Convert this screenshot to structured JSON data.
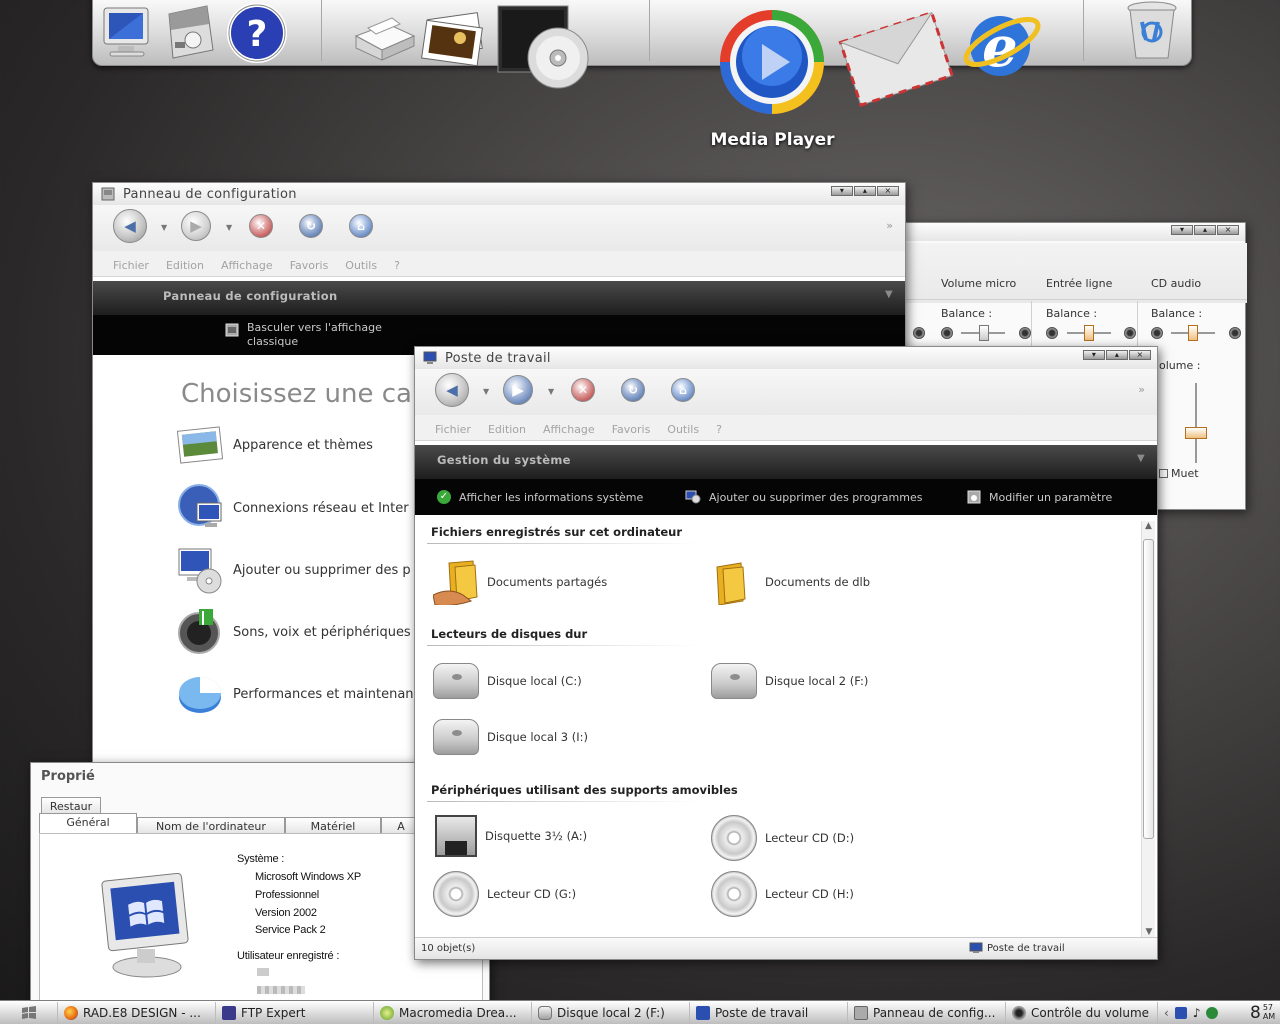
{
  "dock": {
    "hover_label": "Media Player",
    "icons": [
      "monitor-icon",
      "control-panel-icon",
      "help-icon",
      "printer-icon",
      "photos-icon",
      "cd-icon",
      "media-player-icon",
      "mail-icon",
      "internet-explorer-icon",
      "recycle-bin-icon"
    ]
  },
  "control_panel": {
    "title": "Panneau de configuration",
    "menu": [
      "Fichier",
      "Edition",
      "Affichage",
      "Favoris",
      "Outils",
      "?"
    ],
    "task_header": "Panneau de configuration",
    "task_link": "Basculer vers l'affichage classique",
    "task_link_line1": "Basculer vers l'affichage",
    "task_link_line2": "classique",
    "heading": "Choisissez une ca",
    "categories": [
      "Apparence et thèmes",
      "Connexions réseau et Inter",
      "Ajouter ou supprimer des p",
      "Sons, voix et périphériques",
      "Performances et maintenan"
    ]
  },
  "volume": {
    "columns": [
      "Volume micro",
      "Entrée ligne",
      "CD audio"
    ],
    "balance_label": "Balance :",
    "volume_label": "olume :",
    "mute_label": "Muet"
  },
  "properties": {
    "title": "Proprié",
    "tabs_top": [
      "Restaur"
    ],
    "tabs": [
      "Général",
      "Nom de l'ordinateur",
      "Matériel",
      "A"
    ],
    "system_label": "Système :",
    "system_lines": [
      "Microsoft Windows XP",
      "Professionnel",
      "Version 2002",
      "Service Pack 2"
    ],
    "user_label": "Utilisateur enregistré :"
  },
  "my_computer": {
    "title": "Poste de travail",
    "menu": [
      "Fichier",
      "Edition",
      "Affichage",
      "Favoris",
      "Outils",
      "?"
    ],
    "task_header": "Gestion du système",
    "tasks": [
      "Afficher les informations système",
      "Ajouter ou supprimer des programmes",
      "Modifier un paramètre"
    ],
    "groups": [
      {
        "title": "Fichiers enregistrés sur cet ordinateur",
        "items": [
          "Documents partagés",
          "Documents de dlb"
        ]
      },
      {
        "title": "Lecteurs de disques dur",
        "items": [
          "Disque local (C:)",
          "Disque local 2 (F:)",
          "Disque local 3 (I:)"
        ]
      },
      {
        "title": "Périphériques utilisant des supports amovibles",
        "items": [
          "Disquette 3½ (A:)",
          "Lecteur CD (D:)",
          "Lecteur CD (G:)",
          "Lecteur CD (H:)"
        ]
      }
    ],
    "status_count": "10 objet(s)",
    "status_location": "Poste de travail"
  },
  "taskbar": {
    "items": [
      "RAD.E8 DESIGN - ...",
      "FTP Expert",
      "Macromedia Drea...",
      "Disque local 2 (F:)",
      "Poste de travail",
      "Panneau de config...",
      "Contrôle du volume"
    ],
    "clock_hour": "8",
    "clock_minutes": "57",
    "clock_ampm": "AM"
  }
}
